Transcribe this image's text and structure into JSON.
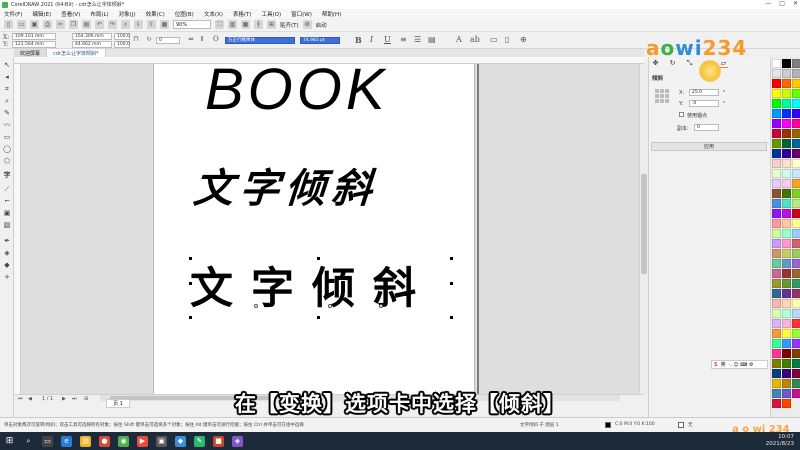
{
  "window": {
    "title": "CorelDRAW 2021 (64-Bit) - cdr怎么让字体倾斜*",
    "controls": [
      "—",
      "□",
      "✕"
    ]
  },
  "menu": [
    "文件(F)",
    "编辑(E)",
    "查看(V)",
    "布局(L)",
    "对象(J)",
    "效果(C)",
    "位图(B)",
    "文本(X)",
    "表格(T)",
    "工具(O)",
    "窗口(W)",
    "帮助(H)"
  ],
  "toolbar": {
    "zoom": "90%",
    "snap_label": "贴齐(T)",
    "launch_label": "启动"
  },
  "propbar": {
    "x": "109.101 mm",
    "y": "121.564 mm",
    "w": "164.306 mm",
    "h": "44.662 mm",
    "scale_w": "100.0",
    "scale_h": "100.0",
    "angle": "0",
    "font": "方正行楷简体",
    "size": "74.983 pt",
    "bold": "B",
    "italic": "I",
    "underline": "U"
  },
  "tabs": {
    "welcome": "欢迎屏幕",
    "document": "cdr怎么让字体倾斜*"
  },
  "canvas": {
    "book": "BOOK",
    "slanted": "文字倾斜",
    "upright": "文字倾斜"
  },
  "page_nav": {
    "position": "1 / 1",
    "page_tab": "页 1"
  },
  "docker": {
    "heading": "倾斜",
    "x_label": "X:",
    "x_value": "25.0",
    "y_label": "Y:",
    "y_value": ".0",
    "anchor_label": "使用锚点",
    "copies_label": "副本:",
    "copies_value": "0",
    "apply": "应用",
    "tab_icons": [
      "✥",
      "↻",
      "⤡",
      "▭",
      "▱"
    ]
  },
  "logo": {
    "text_a": "a",
    "text_o": "o",
    "text_wi": "wi",
    "text_num": "234",
    "small": "a o wi 234"
  },
  "ime": {
    "s": "S",
    "label": "英",
    "icons": "·, ☺ ⌨ ⚙"
  },
  "status": {
    "hint": "单击对象两次可旋转/倾斜；双击工具可选择所有对象；按住 Shift 键单击可选择多个对象；按住 Alt 键单击可进行挖掘；按住 Ctrl 并单击可在组中选择",
    "object": "文字倾斜 于 图层 1",
    "fill_label": "C:0 M:0 Y:0 K:100",
    "outline_label": "无"
  },
  "subtitle": "在【变换】选项卡中选择【倾斜】",
  "clock": {
    "time": "10:07",
    "date": "2021/8/23"
  },
  "palette": [
    "#ffffff",
    "#000000",
    "#7f7f7f",
    "#e6e6e6",
    "#cccccc",
    "#b3b3b3",
    "#ff0000",
    "#ff6600",
    "#ffcc00",
    "#ffff00",
    "#ccff00",
    "#66ff00",
    "#00ff00",
    "#00ff99",
    "#00ffff",
    "#0099ff",
    "#0033ff",
    "#3300ff",
    "#9900ff",
    "#ff00ff",
    "#ff0099",
    "#cc0033",
    "#993300",
    "#996600",
    "#669900",
    "#006633",
    "#006699",
    "#003399",
    "#330099",
    "#660066",
    "#ffcccc",
    "#ffe0cc",
    "#ffffcc",
    "#e6ffcc",
    "#ccffee",
    "#cce6ff",
    "#e6ccff",
    "#ffccee",
    "#f5a623",
    "#8b572a",
    "#417505",
    "#7ed321",
    "#4a90e2",
    "#50e3c2",
    "#b8e986",
    "#9013fe",
    "#bd10e0",
    "#d0021b",
    "#ff9999",
    "#ffcc99",
    "#ffff99",
    "#ccff99",
    "#99ffcc",
    "#99ccff",
    "#cc99ff",
    "#ff99cc",
    "#cc6666",
    "#cc9966",
    "#cccc66",
    "#99cc66",
    "#66cc99",
    "#6699cc",
    "#9966cc",
    "#cc6699",
    "#993333",
    "#996633",
    "#999933",
    "#669933",
    "#339966",
    "#336699",
    "#663399",
    "#993366",
    "#ffb3b3",
    "#ffd9b3",
    "#ffffb3",
    "#d9ffb3",
    "#b3ffd9",
    "#b3d9ff",
    "#d9b3ff",
    "#ffb3d9",
    "#ff3333",
    "#ff9933",
    "#ffff33",
    "#99ff33",
    "#33ff99",
    "#3399ff",
    "#9933ff",
    "#ff3399",
    "#800000",
    "#804000",
    "#808000",
    "#408000",
    "#008040",
    "#004080",
    "#400080",
    "#800040",
    "#e6b800",
    "#b8860b",
    "#2e8b57",
    "#4682b4",
    "#6a5acd",
    "#c71585",
    "#dc143c",
    "#ff4500"
  ]
}
